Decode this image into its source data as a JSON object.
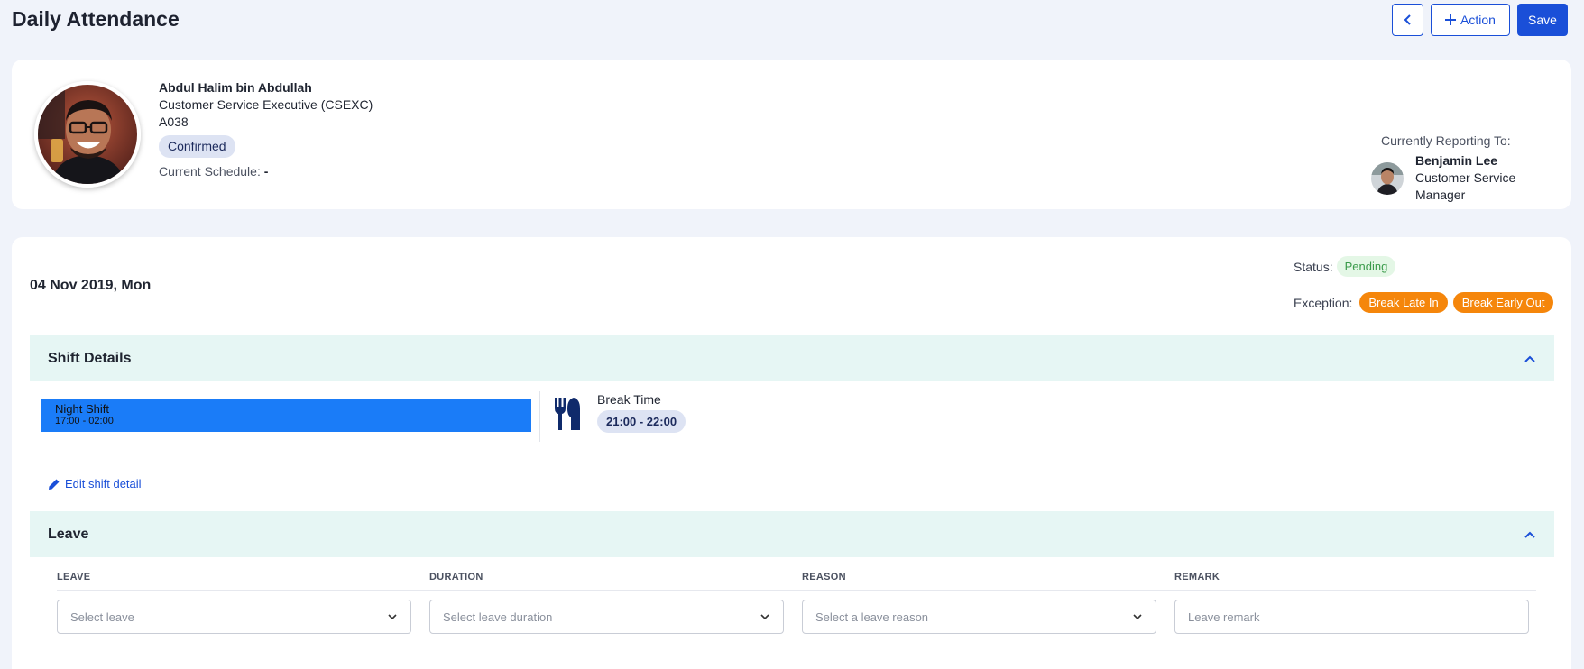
{
  "header": {
    "title": "Daily Attendance",
    "back_icon": "chevron-left-icon",
    "action_label": "Action",
    "save_label": "Save"
  },
  "profile": {
    "name": "Abdul Halim bin Abdullah",
    "position": "Customer Service Executive (CSEXC)",
    "employee_id": "A038",
    "status_badge": "Confirmed",
    "schedule_label": "Current Schedule:",
    "schedule_value": "-",
    "reporting_label": "Currently Reporting To:",
    "manager_name": "Benjamin Lee",
    "manager_title": "Customer Service Manager"
  },
  "attendance": {
    "date": "04 Nov 2019, Mon",
    "status_label": "Status:",
    "status_value": "Pending",
    "exception_label": "Exception:",
    "exceptions": [
      "Break Late In",
      "Break Early Out"
    ]
  },
  "shift_details": {
    "title": "Shift Details",
    "shift_name": "Night Shift",
    "shift_time": "17:00 - 02:00",
    "break_label": "Break Time",
    "break_time": "21:00 - 22:00",
    "edit_label": "Edit shift detail"
  },
  "leave": {
    "title": "Leave",
    "columns": [
      "LEAVE",
      "DURATION",
      "REASON",
      "REMARK"
    ],
    "placeholders": {
      "leave": "Select leave",
      "duration": "Select leave duration",
      "reason": "Select a leave reason",
      "remark": "Leave remark"
    }
  },
  "colors": {
    "primary": "#1a4fd8",
    "shift_bar": "#1a7cf8",
    "exception": "#f5860b",
    "pending_text": "#3a9b4a",
    "section_bg": "#e6f6f4"
  }
}
